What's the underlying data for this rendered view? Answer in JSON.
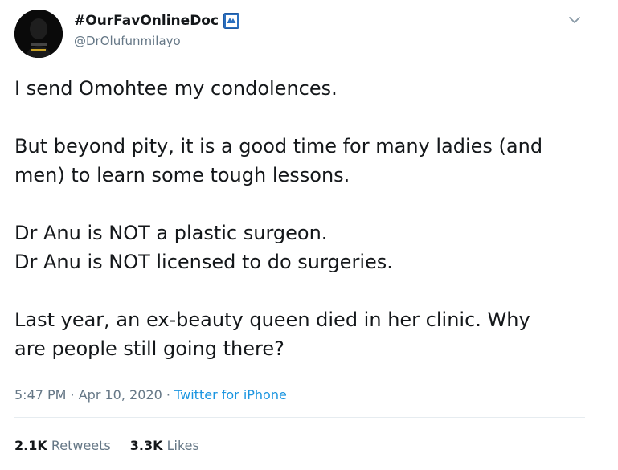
{
  "author": {
    "display_name": "#OurFavOnlineDoc",
    "handle": "@DrOlufunmilayo",
    "badge_icon": "sign-badge-icon",
    "avatar_icon": "profile-avatar"
  },
  "tweet": {
    "paragraphs": [
      [
        "I send Omohtee my condolences."
      ],
      [
        "But beyond pity, it is a good time for many ladies (and",
        "men) to learn some tough lessons."
      ],
      [
        "Dr Anu is NOT a plastic surgeon.",
        "Dr Anu is NOT licensed to do surgeries."
      ],
      [
        "Last year, an ex-beauty queen died in her clinic. Why",
        "are people still going there?"
      ]
    ]
  },
  "meta": {
    "time": "5:47 PM",
    "separator": " · ",
    "date": "Apr 10, 2020",
    "source": "Twitter for iPhone"
  },
  "stats": {
    "retweets_count": "2.1K",
    "retweets_label": "Retweets",
    "likes_count": "3.3K",
    "likes_label": "Likes"
  },
  "colors": {
    "text": "#14171a",
    "secondary": "#657786",
    "link": "#1b95e0",
    "divider": "#e6ecf0"
  }
}
